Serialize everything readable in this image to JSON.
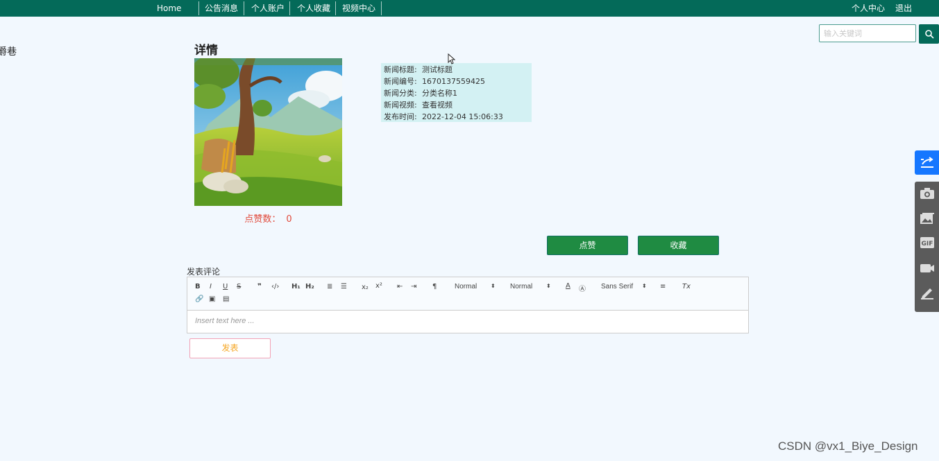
{
  "nav": {
    "home": "Home",
    "items": [
      "公告消息",
      "个人账户",
      "个人收藏",
      "视频中心"
    ],
    "user_center": "个人中心",
    "logout": "退出"
  },
  "search": {
    "placeholder": "输入关键词",
    "icon": "search-icon"
  },
  "left_fragment": "爵巷",
  "detail": {
    "title": "详情",
    "likes_label": "点赞数：",
    "likes_value": "0",
    "info": [
      {
        "label": "新闻标题:",
        "value": "测试标题"
      },
      {
        "label": "新闻编号:",
        "value": "1670137559425"
      },
      {
        "label": "新闻分类:",
        "value": "分类名称1"
      },
      {
        "label": "新闻视频:",
        "value": "查看视频"
      },
      {
        "label": "发布时间:",
        "value": "2022-12-04 15:06:33"
      }
    ],
    "like_button": "点赞",
    "favorite_button": "收藏"
  },
  "comment": {
    "label": "发表评论",
    "editor": {
      "header_select": "Normal",
      "size_select": "Normal",
      "font_select": "Sans Serif",
      "placeholder": "Insert text here ..."
    },
    "publish_button": "发表"
  },
  "colors": {
    "nav_bg": "#046a59",
    "button_green": "#1f8b42",
    "info_bg": "#d3f1f3",
    "likes_red": "#e14a3b",
    "share_blue": "#1677ff"
  },
  "float_toolbar": [
    "share-icon",
    "camera-icon",
    "image-icon",
    "gif-icon",
    "video-icon",
    "pen-icon"
  ],
  "watermark": "CSDN @vx1_Biye_Design"
}
